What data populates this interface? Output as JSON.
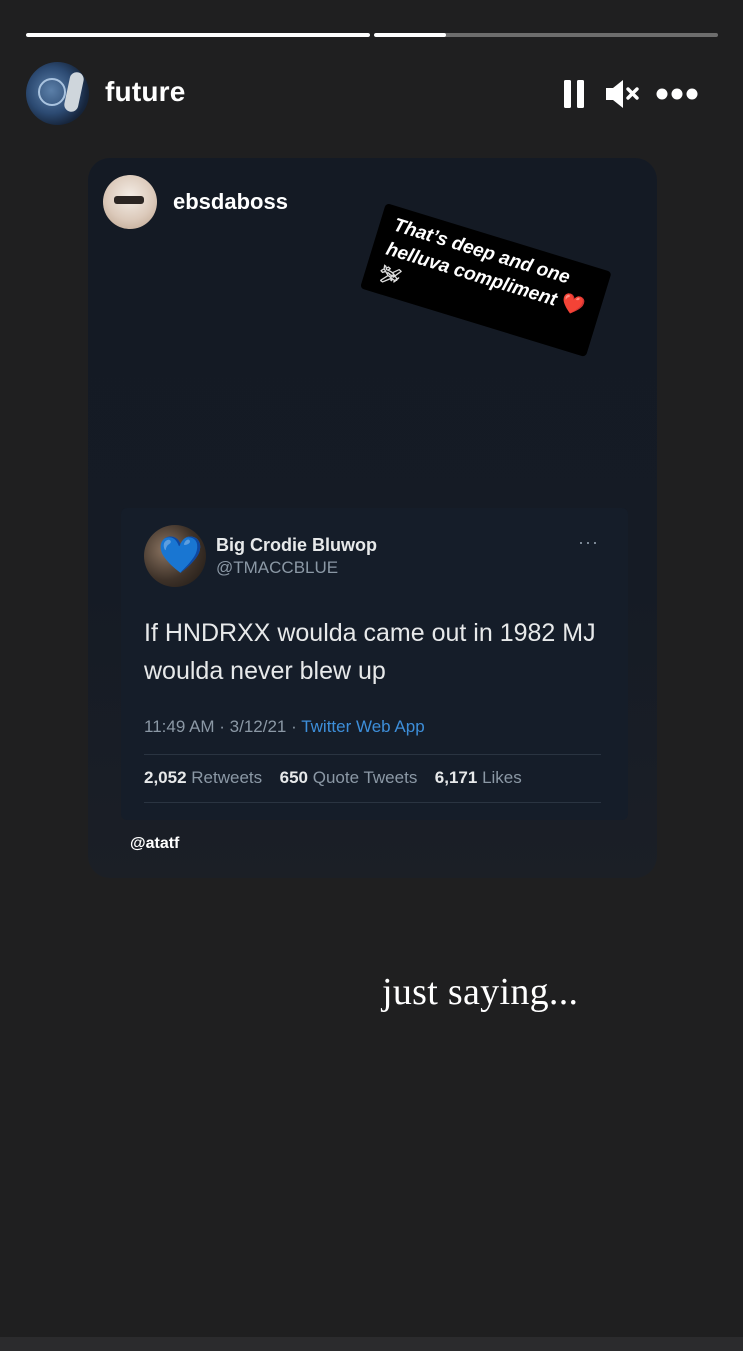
{
  "story": {
    "progress": [
      1.0,
      0.21
    ],
    "username": "future",
    "controls": {
      "pause_icon": "pause-icon",
      "mute_icon": "mute-icon",
      "more_icon": "more-dots-icon"
    }
  },
  "shared_post": {
    "username": "ebsdaboss",
    "sticker_text": "That’s deep and one helluva compliment",
    "sticker_heart": "❤️",
    "sticker_plane": "🛩"
  },
  "tweet": {
    "display_name": "Big Crodie Bluwop",
    "handle": "@TMACCBLUE",
    "avatar_emoji": "💙",
    "more_label": "···",
    "text": "If HNDRXX woulda came out in 1982 MJ woulda never blew up",
    "time": "11:49 AM · 3/12/21 · ",
    "source": "Twitter Web App",
    "stats": [
      {
        "count": "2,052",
        "label": "Retweets"
      },
      {
        "count": "650",
        "label": "Quote Tweets"
      },
      {
        "count": "6,171",
        "label": "Likes"
      }
    ]
  },
  "mention": "@atatf",
  "caption": "just saying..."
}
